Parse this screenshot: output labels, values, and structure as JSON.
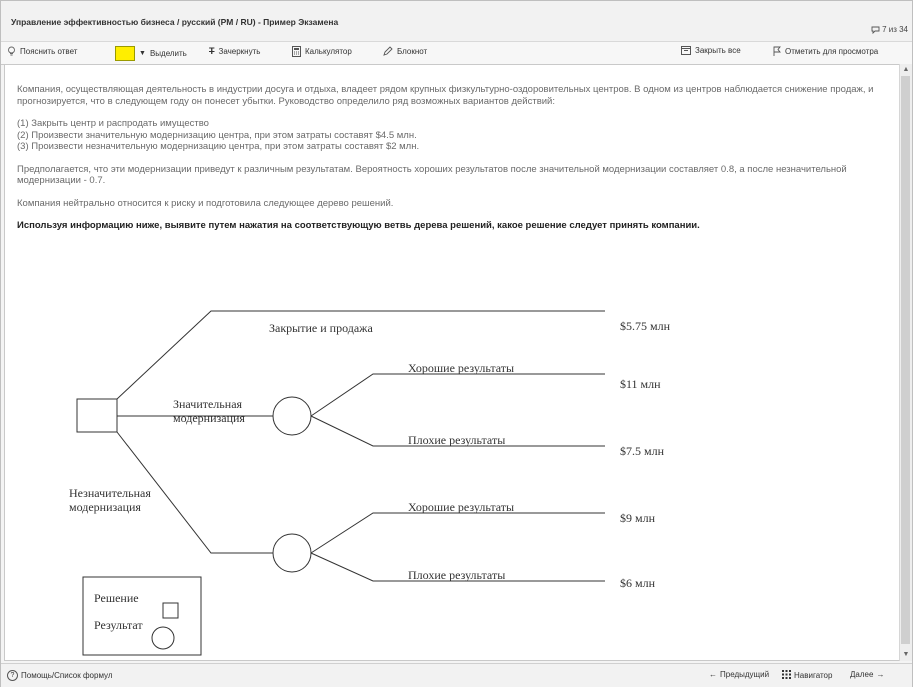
{
  "window": {
    "title": "Управление эффективностью бизнеса / русский (PM / RU) - Пример Экзамена",
    "question_counter": "7 из 34"
  },
  "toolbar": {
    "explain_label": "Пояснить ответ",
    "highlight_label": "Выделить",
    "highlight_color": "#ffee00",
    "strike_label": "Зачеркнуть",
    "calculator_label": "Калькулятор",
    "notepad_label": "Блокнот",
    "close_all_label": "Закрыть все",
    "flag_label": "Отметить для просмотра"
  },
  "question": {
    "intro": "Компания, осуществляющая деятельность в индустрии досуга и отдыха, владеет рядом крупных физкультурно-оздоровительных центров. В одном из центров наблюдается снижение продаж, и прогнозируется, что в следующем году он понесет убытки. Руководство определило ряд возможных вариантов действий:",
    "options": [
      "(1) Закрыть центр и распродать имущество",
      "(2) Произвести значительную модернизацию центра, при этом затраты составят $4.5 млн.",
      "(3) Произвести незначительную модернизацию центра, при этом затраты составят $2 млн."
    ],
    "assumption": "Предполагается, что эти модернизации приведут к различным результатам. Вероятность хороших результатов после значительной модернизации составляет 0.8, а после незначительной модернизации - 0.7.",
    "risk": "Компания нейтрально относится к риску и подготовила следующее дерево решений.",
    "instruction": "Используя информацию ниже, выявите путем нажатия на соответствующую ветвь дерева решений, какое решение следует принять компании."
  },
  "tree": {
    "close_label": "Закрытие и продажа",
    "close_value": "$5.75 млн",
    "major_label_1": "Значительная",
    "major_label_2": "модернизация",
    "major_good_label": "Хорошие результаты",
    "major_good_value": "$11 млн",
    "major_bad_label": "Плохие результаты",
    "major_bad_value": "$7.5 млн",
    "minor_label_1": "Незначительная",
    "minor_label_2": "модернизация",
    "minor_good_label": "Хорошие результаты",
    "minor_good_value": "$9 млн",
    "minor_bad_label": "Плохие результаты",
    "minor_bad_value": "$6 млн",
    "legend_decision": "Решение",
    "legend_outcome": "Результат"
  },
  "footer": {
    "help_label": "Помощь/Список формул",
    "prev_label": "Предыдущий",
    "navigator_label": "Навигатор",
    "next_label": "Далее"
  }
}
